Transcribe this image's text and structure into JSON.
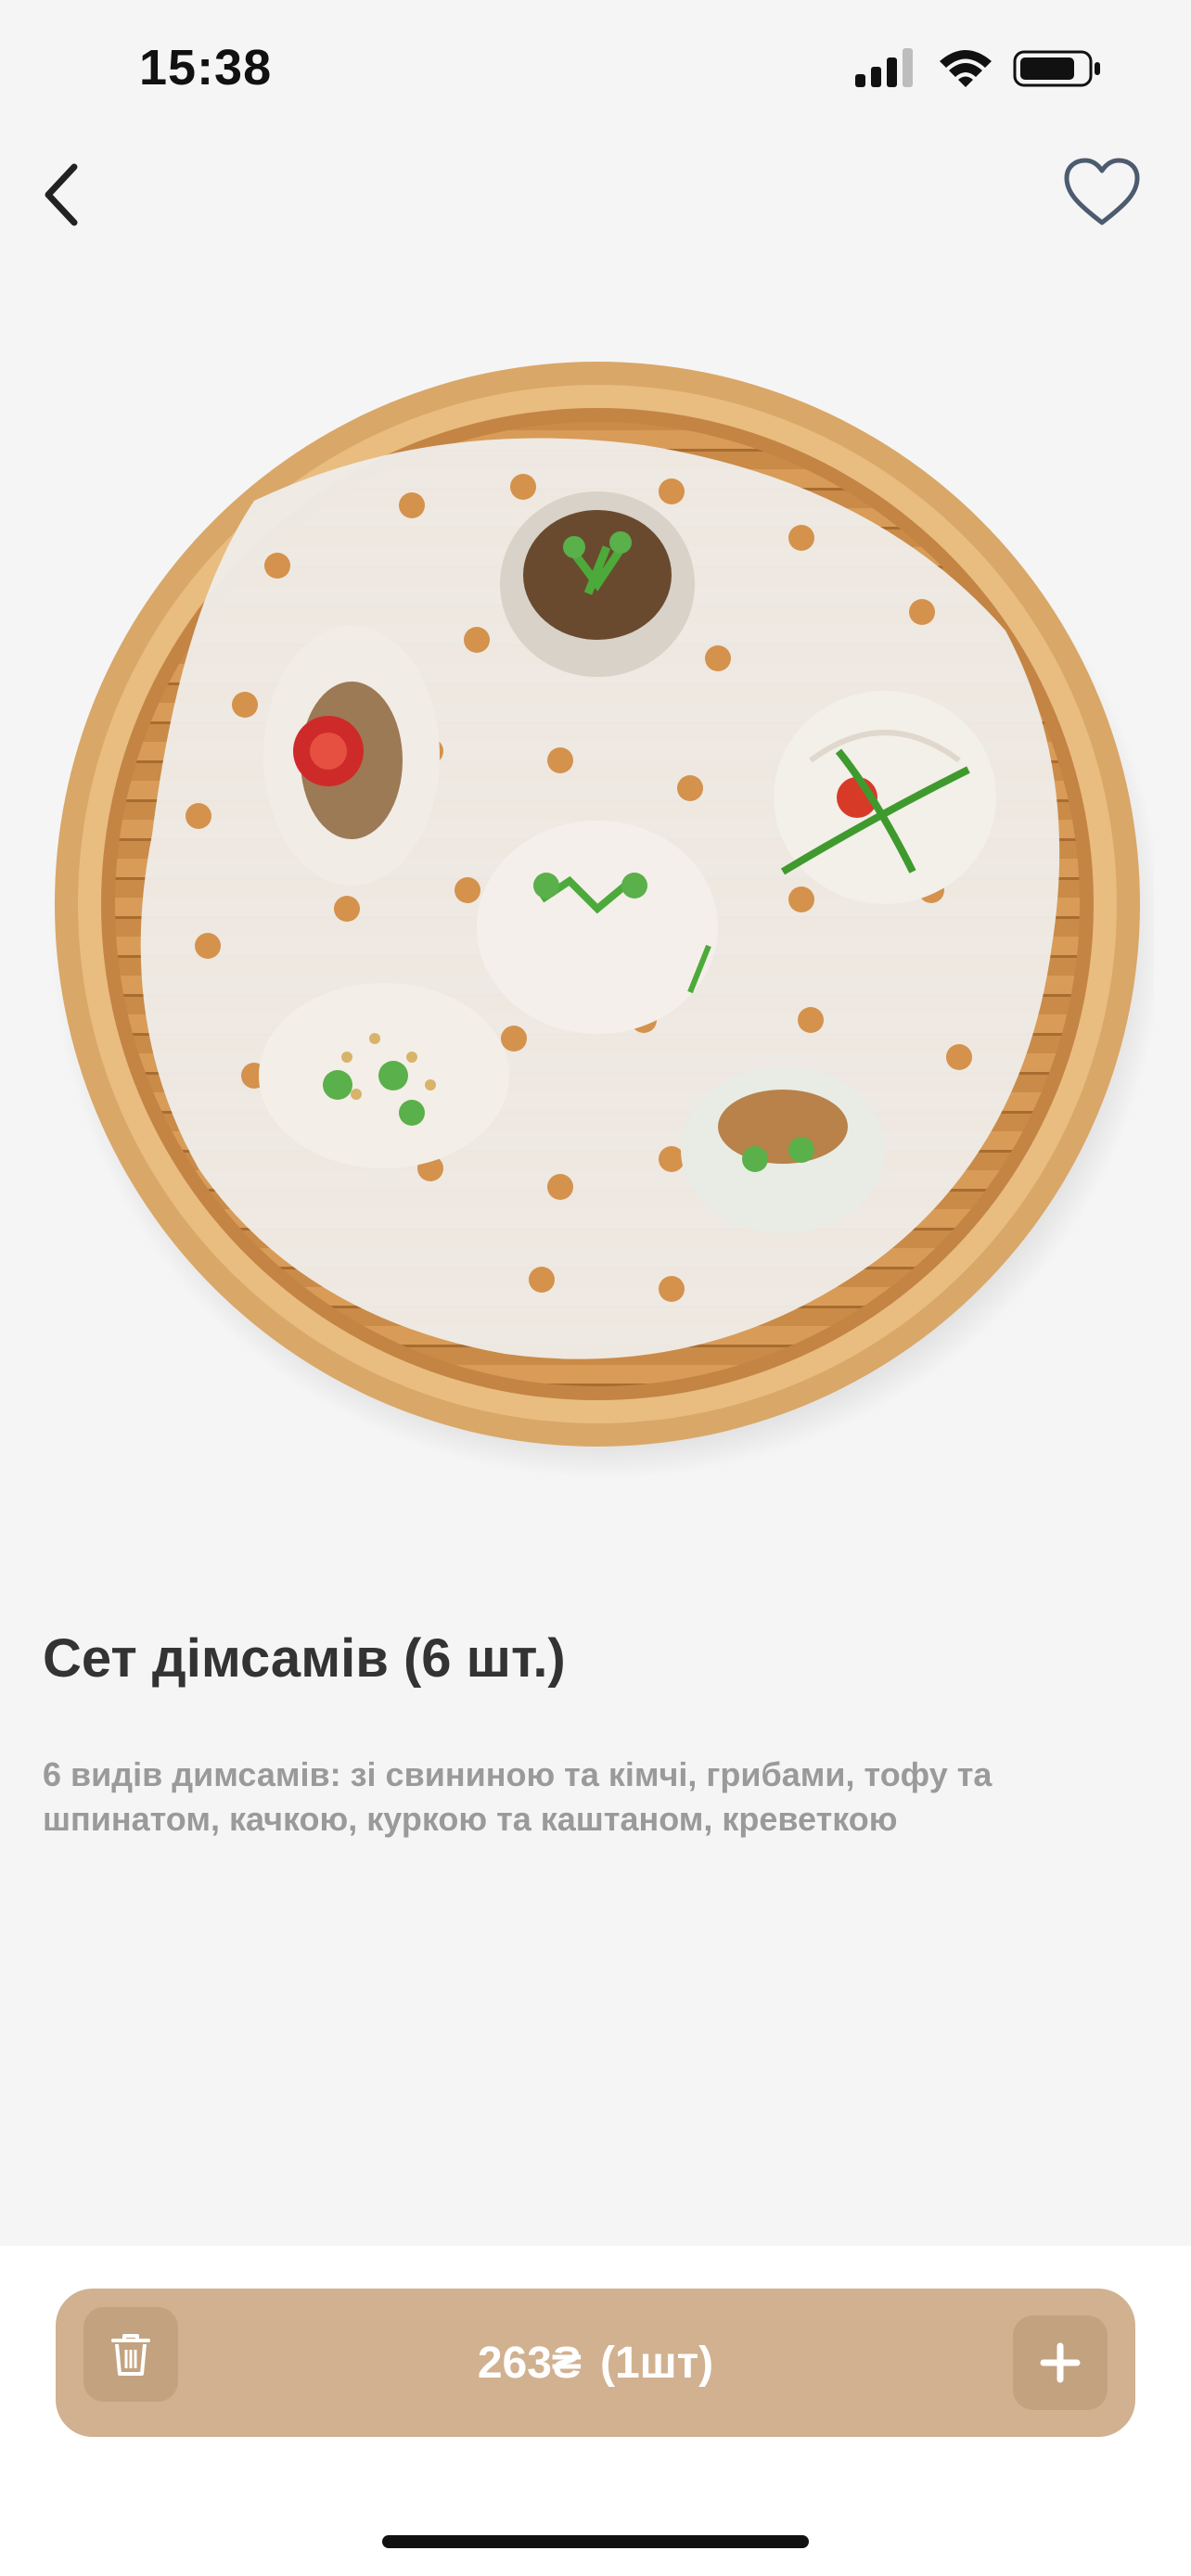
{
  "status_bar": {
    "time": "15:38",
    "icons": [
      "signal-icon",
      "wifi-icon",
      "battery-icon"
    ]
  },
  "nav": {
    "back_icon": "chevron-left-icon",
    "favorite_icon": "heart-outline-icon"
  },
  "product": {
    "image_icon": "dimsum-steamer-photo",
    "title": "Сет дімсамів (6 шт.)",
    "description": "6 видів димсамів: зі свининою та кімчі, грибами, тофу та шпинатом, качкою, куркою та каштаном, креветкою"
  },
  "cart": {
    "price": "263₴",
    "quantity": "(1шт)",
    "delete_icon": "trash-icon",
    "plus_icon": "plus-icon"
  },
  "colors": {
    "background": "#f5f5f5",
    "accent": "#d1b190",
    "accent_dark": "#c3a27f",
    "title": "#333333",
    "description": "#9a9a9a"
  }
}
